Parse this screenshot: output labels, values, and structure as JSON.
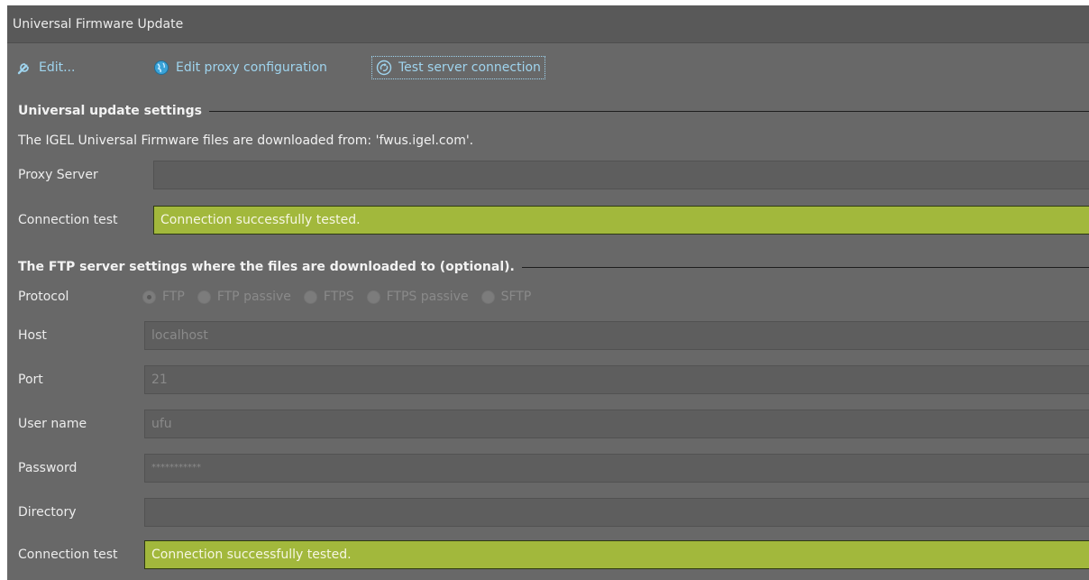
{
  "window": {
    "title": "Universal Firmware Update"
  },
  "toolbar": {
    "edit_label": "Edit...",
    "edit_icon": "wrench-icon",
    "proxy_label": "Edit proxy configuration",
    "proxy_icon": "globe-icon",
    "test_label": "Test server connection",
    "test_icon": "refresh-icon"
  },
  "universal": {
    "title": "Universal update settings",
    "info": "The IGEL Universal Firmware files are downloaded from: 'fwus.igel.com'.",
    "proxy_label": "Proxy Server",
    "proxy_value": "",
    "conn_label": "Connection test",
    "conn_value": "Connection successfully tested."
  },
  "ftp": {
    "title": "The FTP server settings where the files are downloaded to (optional).",
    "protocol_label": "Protocol",
    "protocols": [
      "FTP",
      "FTP passive",
      "FTPS",
      "FTPS passive",
      "SFTP"
    ],
    "selected_protocol": "FTP",
    "host_label": "Host",
    "host_value": "localhost",
    "port_label": "Port",
    "port_value": "21",
    "user_label": "User name",
    "user_value": "ufu",
    "password_label": "Password",
    "password_value": "***********",
    "directory_label": "Directory",
    "directory_value": "",
    "conn_label": "Connection test",
    "conn_value": "Connection successfully tested."
  },
  "colors": {
    "success_green": "#a2b83c",
    "link_blue": "#9fd4ee",
    "background": "#686868"
  }
}
